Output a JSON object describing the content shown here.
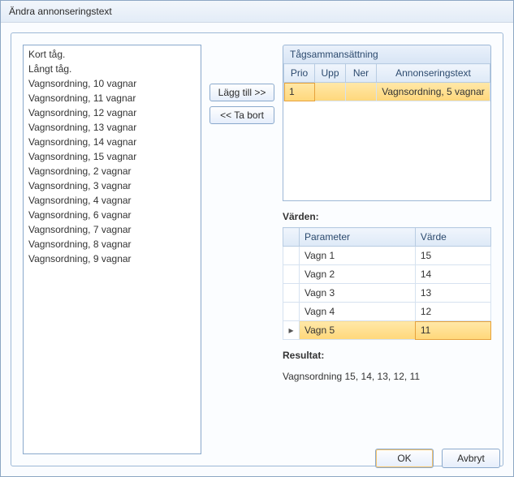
{
  "window": {
    "title": "Ändra annonseringstext"
  },
  "buttons": {
    "add": "Lägg till >>",
    "remove": "<< Ta bort",
    "ok": "OK",
    "cancel": "Avbryt"
  },
  "left_list": [
    "Kort tåg.",
    "Långt tåg.",
    "Vagnsordning, 10 vagnar",
    "Vagnsordning, 11 vagnar",
    "Vagnsordning, 12 vagnar",
    "Vagnsordning, 13 vagnar",
    "Vagnsordning, 14 vagnar",
    "Vagnsordning, 15 vagnar",
    "Vagnsordning, 2 vagnar",
    "Vagnsordning, 3 vagnar",
    "Vagnsordning, 4 vagnar",
    "Vagnsordning, 6 vagnar",
    "Vagnsordning, 7 vagnar",
    "Vagnsordning, 8 vagnar",
    "Vagnsordning, 9 vagnar"
  ],
  "composition": {
    "header": "Tågsammansättning",
    "columns": {
      "prio": "Prio",
      "upp": "Upp",
      "ner": "Ner",
      "text": "Annonseringstext"
    },
    "rows": [
      {
        "prio": "1",
        "upp": "",
        "ner": "",
        "text": "Vagnsordning, 5 vagnar",
        "selected": true
      }
    ]
  },
  "values": {
    "label": "Värden:",
    "columns": {
      "param": "Parameter",
      "value": "Värde"
    },
    "rows": [
      {
        "param": "Vagn 1",
        "value": "15",
        "active": false
      },
      {
        "param": "Vagn 2",
        "value": "14",
        "active": false
      },
      {
        "param": "Vagn 3",
        "value": "13",
        "active": false
      },
      {
        "param": "Vagn 4",
        "value": "12",
        "active": false
      },
      {
        "param": "Vagn 5",
        "value": "11",
        "active": true
      }
    ]
  },
  "result": {
    "label": "Resultat:",
    "text": "Vagnsordning 15, 14, 13, 12, 11"
  }
}
